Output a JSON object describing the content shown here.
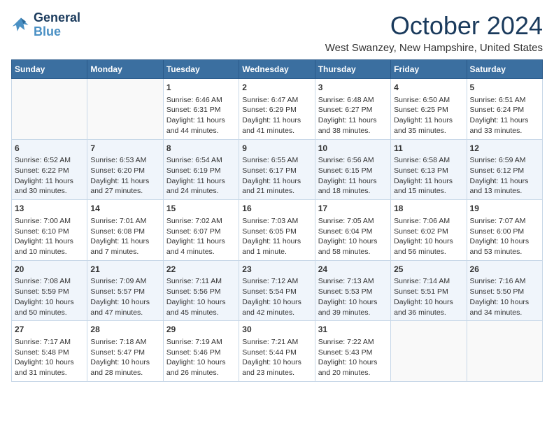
{
  "logo": {
    "text_general": "General",
    "text_blue": "Blue"
  },
  "header": {
    "month": "October 2024",
    "location": "West Swanzey, New Hampshire, United States"
  },
  "days_of_week": [
    "Sunday",
    "Monday",
    "Tuesday",
    "Wednesday",
    "Thursday",
    "Friday",
    "Saturday"
  ],
  "weeks": [
    [
      {
        "day": "",
        "content": ""
      },
      {
        "day": "",
        "content": ""
      },
      {
        "day": "1",
        "content": "Sunrise: 6:46 AM\nSunset: 6:31 PM\nDaylight: 11 hours and 44 minutes."
      },
      {
        "day": "2",
        "content": "Sunrise: 6:47 AM\nSunset: 6:29 PM\nDaylight: 11 hours and 41 minutes."
      },
      {
        "day": "3",
        "content": "Sunrise: 6:48 AM\nSunset: 6:27 PM\nDaylight: 11 hours and 38 minutes."
      },
      {
        "day": "4",
        "content": "Sunrise: 6:50 AM\nSunset: 6:25 PM\nDaylight: 11 hours and 35 minutes."
      },
      {
        "day": "5",
        "content": "Sunrise: 6:51 AM\nSunset: 6:24 PM\nDaylight: 11 hours and 33 minutes."
      }
    ],
    [
      {
        "day": "6",
        "content": "Sunrise: 6:52 AM\nSunset: 6:22 PM\nDaylight: 11 hours and 30 minutes."
      },
      {
        "day": "7",
        "content": "Sunrise: 6:53 AM\nSunset: 6:20 PM\nDaylight: 11 hours and 27 minutes."
      },
      {
        "day": "8",
        "content": "Sunrise: 6:54 AM\nSunset: 6:19 PM\nDaylight: 11 hours and 24 minutes."
      },
      {
        "day": "9",
        "content": "Sunrise: 6:55 AM\nSunset: 6:17 PM\nDaylight: 11 hours and 21 minutes."
      },
      {
        "day": "10",
        "content": "Sunrise: 6:56 AM\nSunset: 6:15 PM\nDaylight: 11 hours and 18 minutes."
      },
      {
        "day": "11",
        "content": "Sunrise: 6:58 AM\nSunset: 6:13 PM\nDaylight: 11 hours and 15 minutes."
      },
      {
        "day": "12",
        "content": "Sunrise: 6:59 AM\nSunset: 6:12 PM\nDaylight: 11 hours and 13 minutes."
      }
    ],
    [
      {
        "day": "13",
        "content": "Sunrise: 7:00 AM\nSunset: 6:10 PM\nDaylight: 11 hours and 10 minutes."
      },
      {
        "day": "14",
        "content": "Sunrise: 7:01 AM\nSunset: 6:08 PM\nDaylight: 11 hours and 7 minutes."
      },
      {
        "day": "15",
        "content": "Sunrise: 7:02 AM\nSunset: 6:07 PM\nDaylight: 11 hours and 4 minutes."
      },
      {
        "day": "16",
        "content": "Sunrise: 7:03 AM\nSunset: 6:05 PM\nDaylight: 11 hours and 1 minute."
      },
      {
        "day": "17",
        "content": "Sunrise: 7:05 AM\nSunset: 6:04 PM\nDaylight: 10 hours and 58 minutes."
      },
      {
        "day": "18",
        "content": "Sunrise: 7:06 AM\nSunset: 6:02 PM\nDaylight: 10 hours and 56 minutes."
      },
      {
        "day": "19",
        "content": "Sunrise: 7:07 AM\nSunset: 6:00 PM\nDaylight: 10 hours and 53 minutes."
      }
    ],
    [
      {
        "day": "20",
        "content": "Sunrise: 7:08 AM\nSunset: 5:59 PM\nDaylight: 10 hours and 50 minutes."
      },
      {
        "day": "21",
        "content": "Sunrise: 7:09 AM\nSunset: 5:57 PM\nDaylight: 10 hours and 47 minutes."
      },
      {
        "day": "22",
        "content": "Sunrise: 7:11 AM\nSunset: 5:56 PM\nDaylight: 10 hours and 45 minutes."
      },
      {
        "day": "23",
        "content": "Sunrise: 7:12 AM\nSunset: 5:54 PM\nDaylight: 10 hours and 42 minutes."
      },
      {
        "day": "24",
        "content": "Sunrise: 7:13 AM\nSunset: 5:53 PM\nDaylight: 10 hours and 39 minutes."
      },
      {
        "day": "25",
        "content": "Sunrise: 7:14 AM\nSunset: 5:51 PM\nDaylight: 10 hours and 36 minutes."
      },
      {
        "day": "26",
        "content": "Sunrise: 7:16 AM\nSunset: 5:50 PM\nDaylight: 10 hours and 34 minutes."
      }
    ],
    [
      {
        "day": "27",
        "content": "Sunrise: 7:17 AM\nSunset: 5:48 PM\nDaylight: 10 hours and 31 minutes."
      },
      {
        "day": "28",
        "content": "Sunrise: 7:18 AM\nSunset: 5:47 PM\nDaylight: 10 hours and 28 minutes."
      },
      {
        "day": "29",
        "content": "Sunrise: 7:19 AM\nSunset: 5:46 PM\nDaylight: 10 hours and 26 minutes."
      },
      {
        "day": "30",
        "content": "Sunrise: 7:21 AM\nSunset: 5:44 PM\nDaylight: 10 hours and 23 minutes."
      },
      {
        "day": "31",
        "content": "Sunrise: 7:22 AM\nSunset: 5:43 PM\nDaylight: 10 hours and 20 minutes."
      },
      {
        "day": "",
        "content": ""
      },
      {
        "day": "",
        "content": ""
      }
    ]
  ]
}
